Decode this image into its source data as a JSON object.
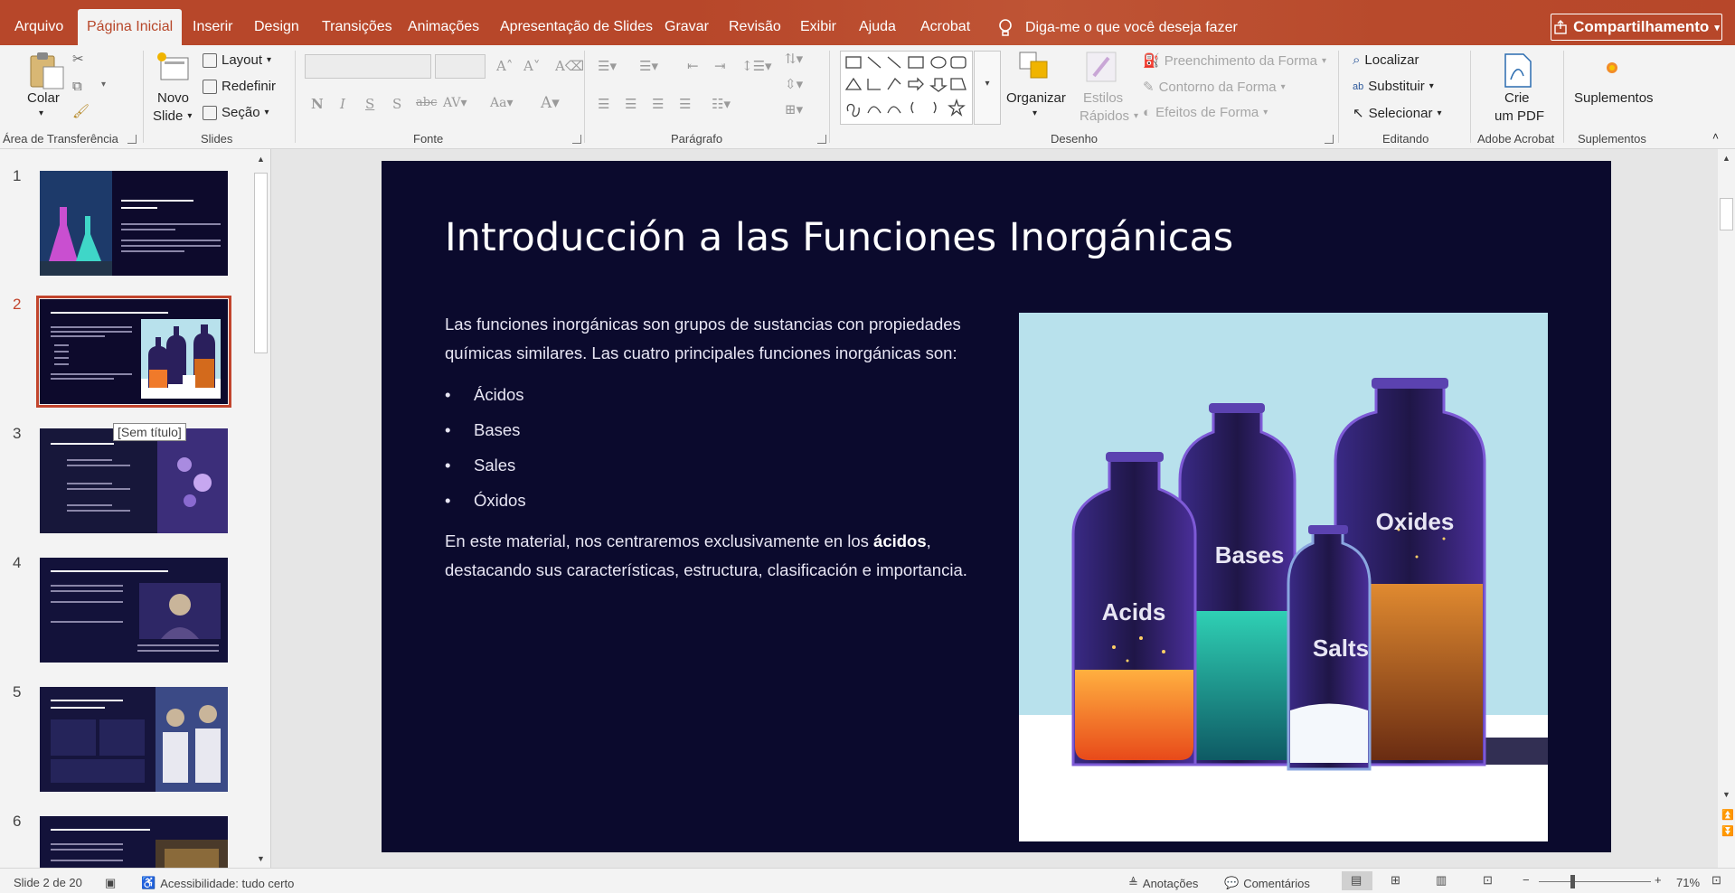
{
  "menu": {
    "tabs": [
      "Arquivo",
      "Página Inicial",
      "Inserir",
      "Design",
      "Transições",
      "Animações",
      "Apresentação de Slides",
      "Gravar",
      "Revisão",
      "Exibir",
      "Ajuda",
      "Acrobat"
    ],
    "tell_me": "Diga-me o que você deseja fazer",
    "share": "Compartilhamento"
  },
  "ribbon": {
    "clipboard": {
      "paste": "Colar",
      "label": "Área de Transferência"
    },
    "slides": {
      "new_slide_1": "Novo",
      "new_slide_2": "Slide",
      "layout": "Layout",
      "reset": "Redefinir",
      "section": "Seção",
      "label": "Slides"
    },
    "font": {
      "label": "Fonte"
    },
    "paragraph": {
      "label": "Parágrafo"
    },
    "drawing": {
      "arrange": "Organizar",
      "quick_styles_1": "Estilos",
      "quick_styles_2": "Rápidos",
      "shape_fill": "Preenchimento da Forma",
      "shape_outline": "Contorno da Forma",
      "shape_effects": "Efeitos de Forma",
      "label": "Desenho"
    },
    "editing": {
      "find": "Localizar",
      "replace": "Substituir",
      "select": "Selecionar",
      "label": "Editando"
    },
    "acrobat": {
      "create_1": "Crie",
      "create_2": "um PDF",
      "label": "Adobe Acrobat"
    },
    "addins": {
      "button": "Suplementos",
      "label": "Suplementos"
    }
  },
  "thumbnails": {
    "numbers": [
      "1",
      "2",
      "3",
      "4",
      "5",
      "6"
    ],
    "tooltip": "[Sem título]"
  },
  "slide": {
    "title": "Introducción a las Funciones Inorgánicas",
    "intro": "Las funciones inorgánicas son grupos de sustancias con propiedades químicas similares. Las cuatro principales funciones inorgánicas son:",
    "bullets": [
      "Ácidos",
      "Bases",
      "Sales",
      "Óxidos"
    ],
    "closing_pre": "En este material, nos centraremos exclusivamente en los ",
    "closing_bold": "ácidos",
    "closing_post": ", destacando sus características, estructura, clasificación e importancia.",
    "image_labels": {
      "acids": "Acids",
      "bases": "Bases",
      "salts": "Salts",
      "oxides": "Oxides"
    }
  },
  "status": {
    "slide_count": "Slide 2 de 20",
    "accessibility": "Acessibilidade: tudo certo",
    "notes": "Anotações",
    "comments": "Comentários",
    "zoom": "71%"
  },
  "colors": {
    "accent": "#b7472a",
    "slide_bg": "#0b0a2d",
    "image_bg": "#b8e1ec"
  }
}
